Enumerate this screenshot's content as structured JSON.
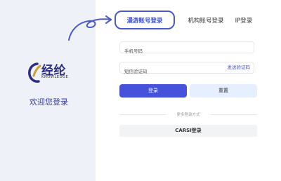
{
  "brand": {
    "logo_cn": "经纶",
    "logo_en": "KNOWLEDGE",
    "welcome": "欢迎您登录",
    "colors": {
      "primary": "#4752db",
      "brand_navy": "#2b2d80",
      "panel_bg": "#eef1f7"
    }
  },
  "tabs": [
    {
      "label": "漫游账号登录",
      "active": true
    },
    {
      "label": "机构账号登录",
      "active": false
    },
    {
      "label": "IP登录",
      "active": false
    }
  ],
  "form": {
    "phone": {
      "placeholder": "手机号码",
      "value": ""
    },
    "code": {
      "placeholder": "短信验证码",
      "value": ""
    },
    "send_code_label": "发送验证码",
    "login_label": "登录",
    "reset_label": "重置"
  },
  "more": {
    "divider_label": "更多登录方式",
    "carsi_label": "CARSI登录"
  },
  "icons": [
    "logo-icon",
    "hand-drawn-arrow-icon"
  ]
}
